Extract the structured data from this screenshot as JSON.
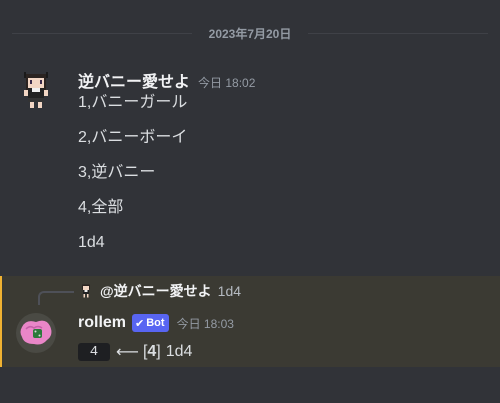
{
  "date_divider": "2023年7月20日",
  "message1": {
    "username": "逆バニー愛せよ",
    "timestamp": "今日 18:02",
    "lines": [
      "1,バニーガール",
      "2,バニーボーイ",
      "3,逆バニー",
      "4,全部",
      "1d4"
    ]
  },
  "message2": {
    "reply": {
      "mention": "@逆バニー愛せよ",
      "snippet": "1d4"
    },
    "username": "rollem",
    "bot_badge": "Bot",
    "timestamp": "今日 18:03",
    "result_code": "4",
    "arrow": "⟵",
    "bracket_open": "[",
    "bracket_value": "4",
    "bracket_close": "]",
    "roll": "1d4"
  },
  "colors": {
    "background": "#313338",
    "highlight": "#3b3a33",
    "highlight_accent": "#f0b232",
    "bot_badge": "#5865f2"
  },
  "icons": {
    "avatar1": "pixel-character-avatar",
    "avatar2": "pink-dice-avatar",
    "bot_check": "check-icon"
  }
}
